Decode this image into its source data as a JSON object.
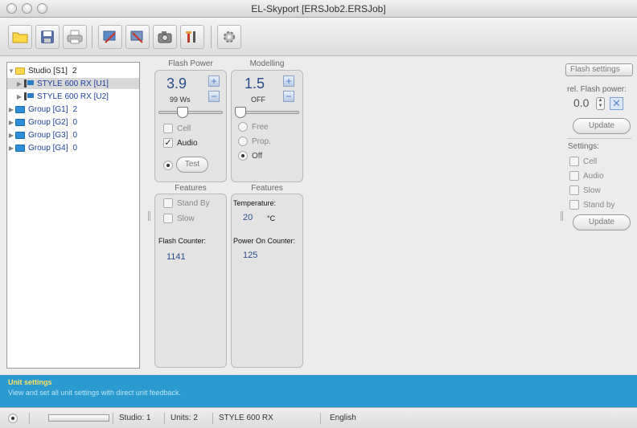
{
  "window": {
    "title": "EL-Skyport  [ERSJob2.ERSJob]"
  },
  "toolbar": {
    "buttons": [
      "open-icon",
      "save-icon",
      "print-icon",
      "tool-icon",
      "tool2-icon",
      "camera-icon",
      "settings-tools-icon",
      "gear-icon"
    ]
  },
  "tree": {
    "studio": {
      "label": "Studio [S1]",
      "count": "2"
    },
    "units": [
      {
        "label": "STYLE 600 RX [U1]"
      },
      {
        "label": "STYLE 600 RX [U2]"
      }
    ],
    "groups": [
      {
        "label": "Group [G1]",
        "count": "2"
      },
      {
        "label": "Group [G2]",
        "count": "0"
      },
      {
        "label": "Group [G3]",
        "count": "0"
      },
      {
        "label": "Group [G4]",
        "count": "0"
      }
    ]
  },
  "flash_power": {
    "header": "Flash Power",
    "value": "3.9",
    "ws": "99 Ws",
    "slider_fraction": 0.35,
    "cell": "Cell",
    "audio": "Audio",
    "audio_checked": true,
    "test": "Test"
  },
  "modelling": {
    "header": "Modelling",
    "value": "1.5",
    "mode": "OFF",
    "slider_fraction": 0.0,
    "free": "Free",
    "prop": "Prop.",
    "off": "Off"
  },
  "features_left": {
    "header": "Features",
    "standby": "Stand By",
    "slow": "Slow",
    "flash_counter_label": "Flash Counter:",
    "flash_counter": "1141"
  },
  "features_right": {
    "header": "Features",
    "temperature_label": "Temperature:",
    "temperature": "20",
    "temperature_unit": "°C",
    "power_on_label": "Power On Counter:",
    "power_on": "125"
  },
  "right_panel": {
    "dropdown": "Flash settings",
    "rel_label": "rel. Flash power:",
    "rel_value": "0.0",
    "update1": "Update",
    "settings_label": "Settings:",
    "cell": "Cell",
    "audio": "Audio",
    "slow": "Slow",
    "standby": "Stand by",
    "update2": "Update"
  },
  "info": {
    "title": "Unit settings",
    "desc": "View and set all unit settings with direct unit feedback."
  },
  "status": {
    "studio": "Studio: 1",
    "units": "Units: 2",
    "model": "STYLE 600 RX",
    "language": "English"
  },
  "colors": {
    "accent": "#2b9ad0",
    "value_blue": "#2a4c8a",
    "info_title": "#ffe066"
  }
}
